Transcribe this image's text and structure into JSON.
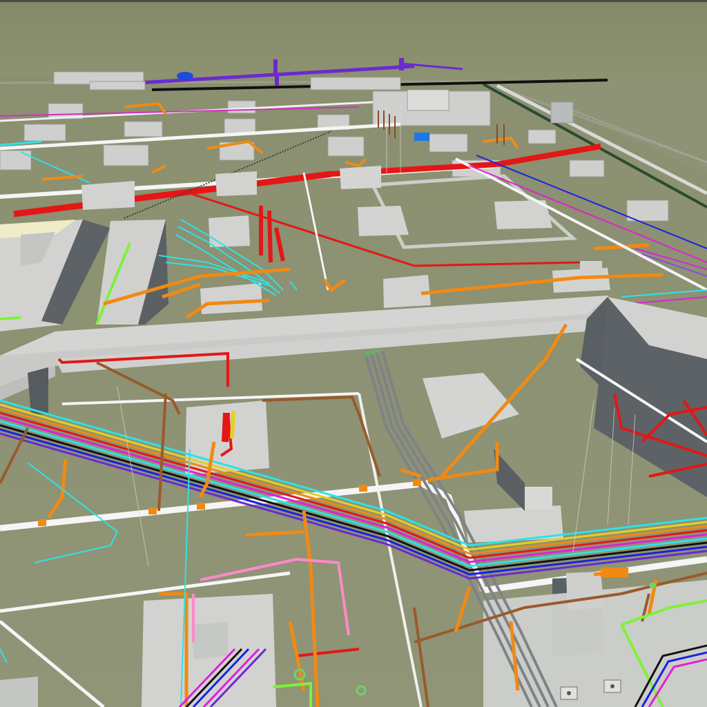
{
  "viewport": {
    "kind": "3d-bim-utility-model",
    "colors": {
      "sky": "#8b8e6c",
      "ground": "#8c9274",
      "concrete_top": "#d2d3d1",
      "concrete_side": "#5d6266",
      "pipe_red": "#e41616",
      "pipe_orange": "#f08a14",
      "pipe_brown": "#9a5a2c",
      "pipe_cyan": "#2ee2e8",
      "pipe_white": "#f5f5f5",
      "pipe_blue": "#1a20e0",
      "pipe_magenta": "#e020d8",
      "pipe_purple": "#6a2ad0",
      "pipe_green": "#7ef23a",
      "pipe_gray": "#8a8c90",
      "pipe_black": "#111111",
      "pipe_pink": "#ff88cc",
      "pipe_yellow": "#e8d020"
    },
    "icons": [
      "manhole-block",
      "valve-fitting",
      "elbow-fitting"
    ]
  }
}
